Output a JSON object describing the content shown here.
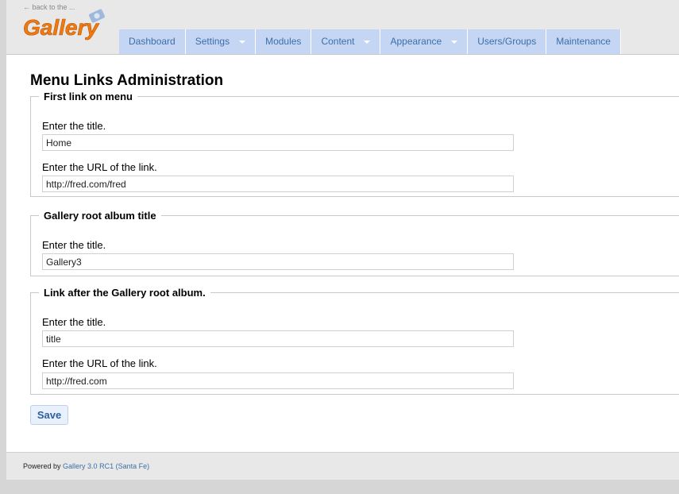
{
  "header": {
    "back_link": "← back to the ...",
    "logo_text": "Gallery"
  },
  "nav": {
    "items": [
      {
        "label": "Dashboard",
        "dropdown": false
      },
      {
        "label": "Settings",
        "dropdown": true
      },
      {
        "label": "Modules",
        "dropdown": false
      },
      {
        "label": "Content",
        "dropdown": true
      },
      {
        "label": "Appearance",
        "dropdown": true
      },
      {
        "label": "Users/Groups",
        "dropdown": false
      },
      {
        "label": "Maintenance",
        "dropdown": false
      }
    ]
  },
  "main": {
    "title": "Menu Links Administration",
    "first_link": {
      "legend": "First link on menu",
      "title_label": "Enter the title.",
      "title_value": "Home",
      "url_label": "Enter the URL of the link.",
      "url_value": "http://fred.com/fred"
    },
    "root_album": {
      "legend": "Gallery root album title",
      "title_label": "Enter the title.",
      "title_value": "Gallery3"
    },
    "after_link": {
      "legend": "Link after the Gallery root album.",
      "title_label": "Enter the title.",
      "title_value": "title",
      "url_label": "Enter the URL of the link.",
      "url_value": "http://fred.com"
    },
    "save_label": "Save"
  },
  "footer": {
    "powered_by": "Powered by",
    "version_link": "Gallery 3.0 RC1 (Santa Fe)"
  },
  "colors": {
    "nav_bg": "#c5d6f5",
    "nav_text": "#3c6ea8",
    "logo_orange": "#f07a12"
  }
}
